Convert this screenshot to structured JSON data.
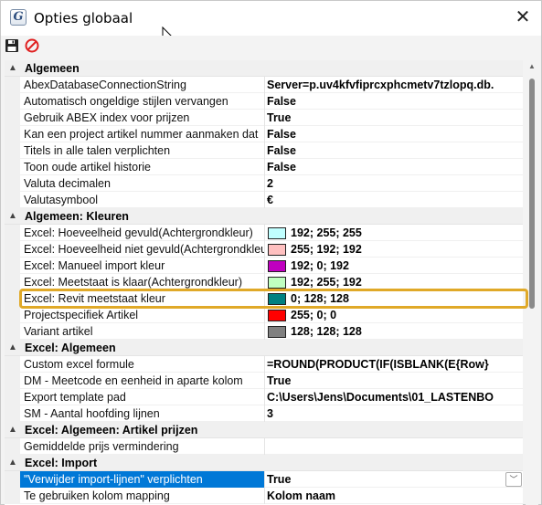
{
  "window": {
    "title": "Opties globaal",
    "app_icon": "G",
    "close_glyph": "✕",
    "icons": {
      "app": "abex-g-icon",
      "close": "close-icon",
      "save": "save-icon",
      "cancel": "cancel-icon",
      "cursor": "mouse-cursor-icon"
    }
  },
  "colors": {
    "selection": "#0078d7",
    "highlight_border": "#e0a928",
    "category_bg": "#f0f0f0"
  },
  "grid": {
    "categories": [
      {
        "label": "Algemeen",
        "toggle": "▲",
        "rows": [
          {
            "name": "AbexDatabaseConnectionString",
            "value": "Server=p.uv4kfvfiprcxphcmetv7tzlopq.db."
          },
          {
            "name": "Automatisch ongeldige stijlen vervangen",
            "value": "False"
          },
          {
            "name": "Gebruik ABEX index voor prijzen",
            "value": "True"
          },
          {
            "name": "Kan een project artikel nummer aanmaken dat",
            "value": "False"
          },
          {
            "name": "Titels in alle talen verplichten",
            "value": "False"
          },
          {
            "name": "Toon oude artikel historie",
            "value": "False"
          },
          {
            "name": "Valuta decimalen",
            "value": "2"
          },
          {
            "name": "Valutasymbool",
            "value": "€"
          }
        ]
      },
      {
        "label": "Algemeen: Kleuren",
        "toggle": "▲",
        "rows": [
          {
            "name": "Excel: Hoeveelheid gevuld(Achtergrondkleur)",
            "value": "192; 255; 255",
            "swatch": "#c0ffff"
          },
          {
            "name": "Excel: Hoeveelheid niet gevuld(Achtergrondkleur)",
            "value": "255; 192; 192",
            "swatch": "#ffc0c0"
          },
          {
            "name": "Excel: Manueel import kleur",
            "value": "192; 0; 192",
            "swatch": "#c000c0"
          },
          {
            "name": "Excel: Meetstaat is klaar(Achtergrondkleur)",
            "value": "192; 255; 192",
            "swatch": "#c0ffc0"
          },
          {
            "name": "Excel: Revit meetstaat kleur",
            "value": "0; 128; 128",
            "swatch": "#008080"
          },
          {
            "name": "Projectspecifiek Artikel",
            "value": "255; 0; 0",
            "swatch": "#ff0000"
          },
          {
            "name": "Variant artikel",
            "value": "128; 128; 128",
            "swatch": "#808080"
          }
        ]
      },
      {
        "label": "Excel: Algemeen",
        "toggle": "▲",
        "rows": [
          {
            "name": "Custom excel formule",
            "value": "=ROUND(PRODUCT(IF(ISBLANK(E{Row}"
          },
          {
            "name": "DM - Meetcode en eenheid in aparte kolom",
            "value": "True"
          },
          {
            "name": "Export template pad",
            "value": "C:\\Users\\Jens\\Documents\\01_LASTENBO"
          },
          {
            "name": "SM - Aantal hoofding lijnen",
            "value": "3"
          }
        ]
      },
      {
        "label": "Excel: Algemeen: Artikel prijzen",
        "toggle": "▲",
        "rows": [
          {
            "name": "Gemiddelde prijs vermindering",
            "value": ""
          }
        ]
      },
      {
        "label": "Excel: Import",
        "toggle": "▲",
        "rows": [
          {
            "name": "\"Verwijder import-lijnen\" verplichten",
            "value": "True",
            "selected": true,
            "dropdown": "﹀"
          },
          {
            "name": "Te gebruiken kolom mapping",
            "value": "Kolom naam"
          }
        ]
      }
    ]
  },
  "scrollbar": {
    "up_glyph": "▲"
  }
}
